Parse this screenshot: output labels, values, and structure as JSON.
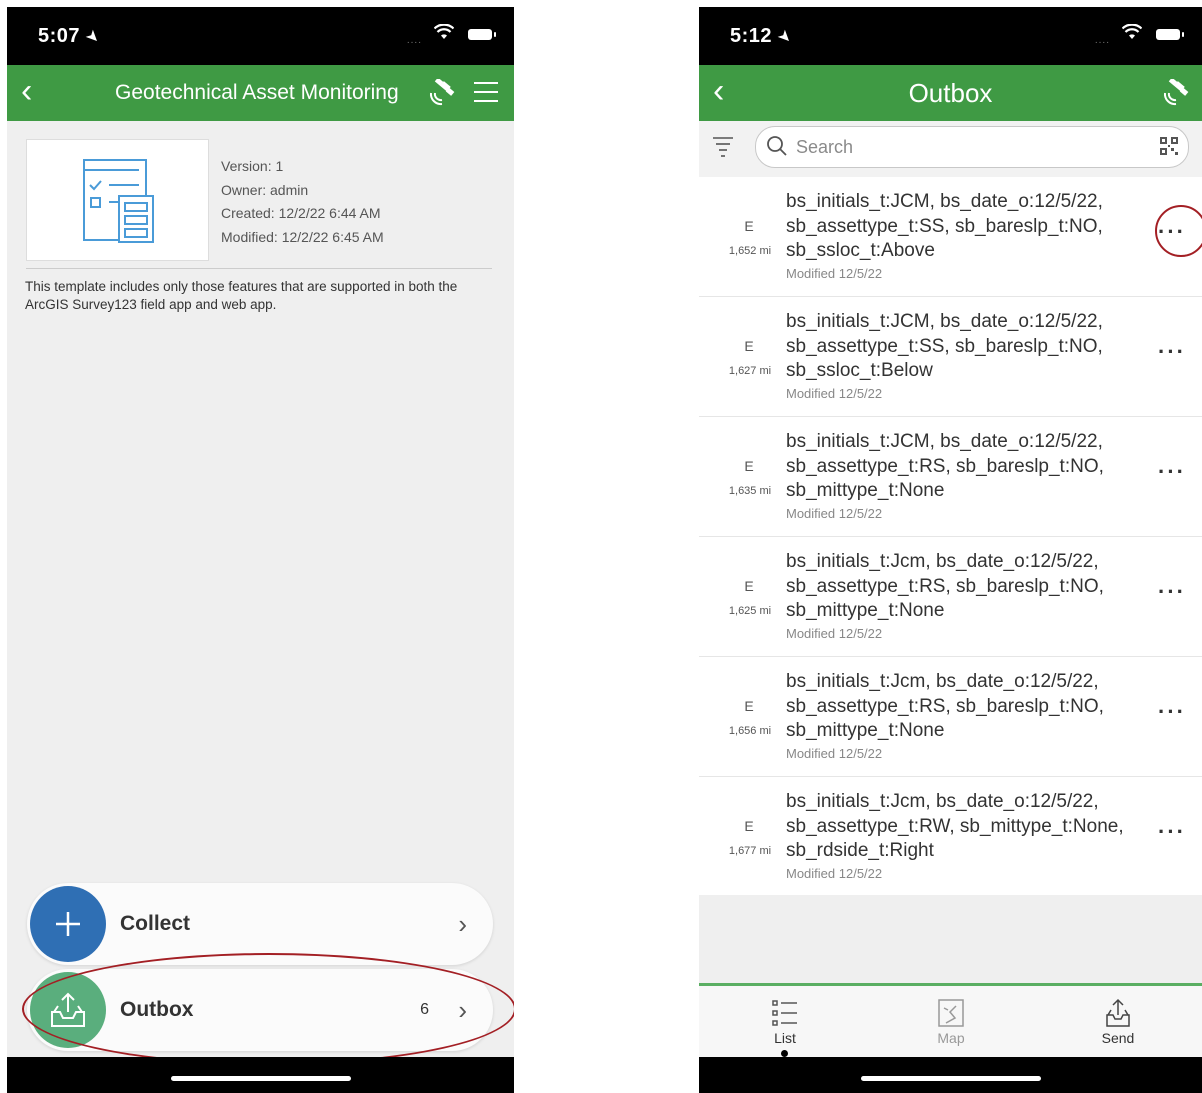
{
  "left_screen": {
    "status": {
      "time": "5:07"
    },
    "navbar": {
      "title": "Geotechnical Asset Monitoring"
    },
    "survey": {
      "version": "Version: 1",
      "owner": "Owner: admin",
      "created": "Created: 12/2/22 6:44 AM",
      "modified": "Modified: 12/2/22 6:45 AM",
      "description": "This template includes only those features that are supported in both the ArcGIS Survey123 field app and web app."
    },
    "actions": {
      "collect_label": "Collect",
      "outbox_label": "Outbox",
      "outbox_count": "6"
    },
    "colors": {
      "primary": "#3f9a44",
      "collect": "#2f6fb4",
      "outbox": "#5aae7d",
      "highlight": "#a31f24"
    }
  },
  "right_screen": {
    "status": {
      "time": "5:12"
    },
    "navbar": {
      "title": "Outbox"
    },
    "search": {
      "placeholder": "Search"
    },
    "items": [
      {
        "direction": "E",
        "distance": "1,652 mi",
        "line1": "bs_initials_t:JCM, bs_date_o:12/5/22,",
        "line2": "sb_assettype_t:SS, sb_bareslp_t:NO,",
        "line3": "sb_ssloc_t:Above",
        "modified": "Modified 12/5/22"
      },
      {
        "direction": "E",
        "distance": "1,627 mi",
        "line1": "bs_initials_t:JCM, bs_date_o:12/5/22,",
        "line2": "sb_assettype_t:SS, sb_bareslp_t:NO,",
        "line3": "sb_ssloc_t:Below",
        "modified": "Modified 12/5/22"
      },
      {
        "direction": "E",
        "distance": "1,635 mi",
        "line1": "bs_initials_t:JCM, bs_date_o:12/5/22,",
        "line2": "sb_assettype_t:RS, sb_bareslp_t:NO,",
        "line3": "sb_mittype_t:None",
        "modified": "Modified 12/5/22"
      },
      {
        "direction": "E",
        "distance": "1,625 mi",
        "line1": "bs_initials_t:Jcm, bs_date_o:12/5/22,",
        "line2": "sb_assettype_t:RS, sb_bareslp_t:NO,",
        "line3": "sb_mittype_t:None",
        "modified": "Modified 12/5/22"
      },
      {
        "direction": "E",
        "distance": "1,656 mi",
        "line1": "bs_initials_t:Jcm, bs_date_o:12/5/22,",
        "line2": "sb_assettype_t:RS, sb_bareslp_t:NO,",
        "line3": "sb_mittype_t:None",
        "modified": "Modified 12/5/22"
      },
      {
        "direction": "E",
        "distance": "1,677 mi",
        "line1": "bs_initials_t:Jcm, bs_date_o:12/5/22,",
        "line2": "sb_assettype_t:RW, sb_mittype_t:None,",
        "line3": "sb_rdside_t:Right",
        "modified": "Modified 12/5/22"
      }
    ],
    "tabs": {
      "list": "List",
      "map": "Map",
      "send": "Send"
    }
  }
}
